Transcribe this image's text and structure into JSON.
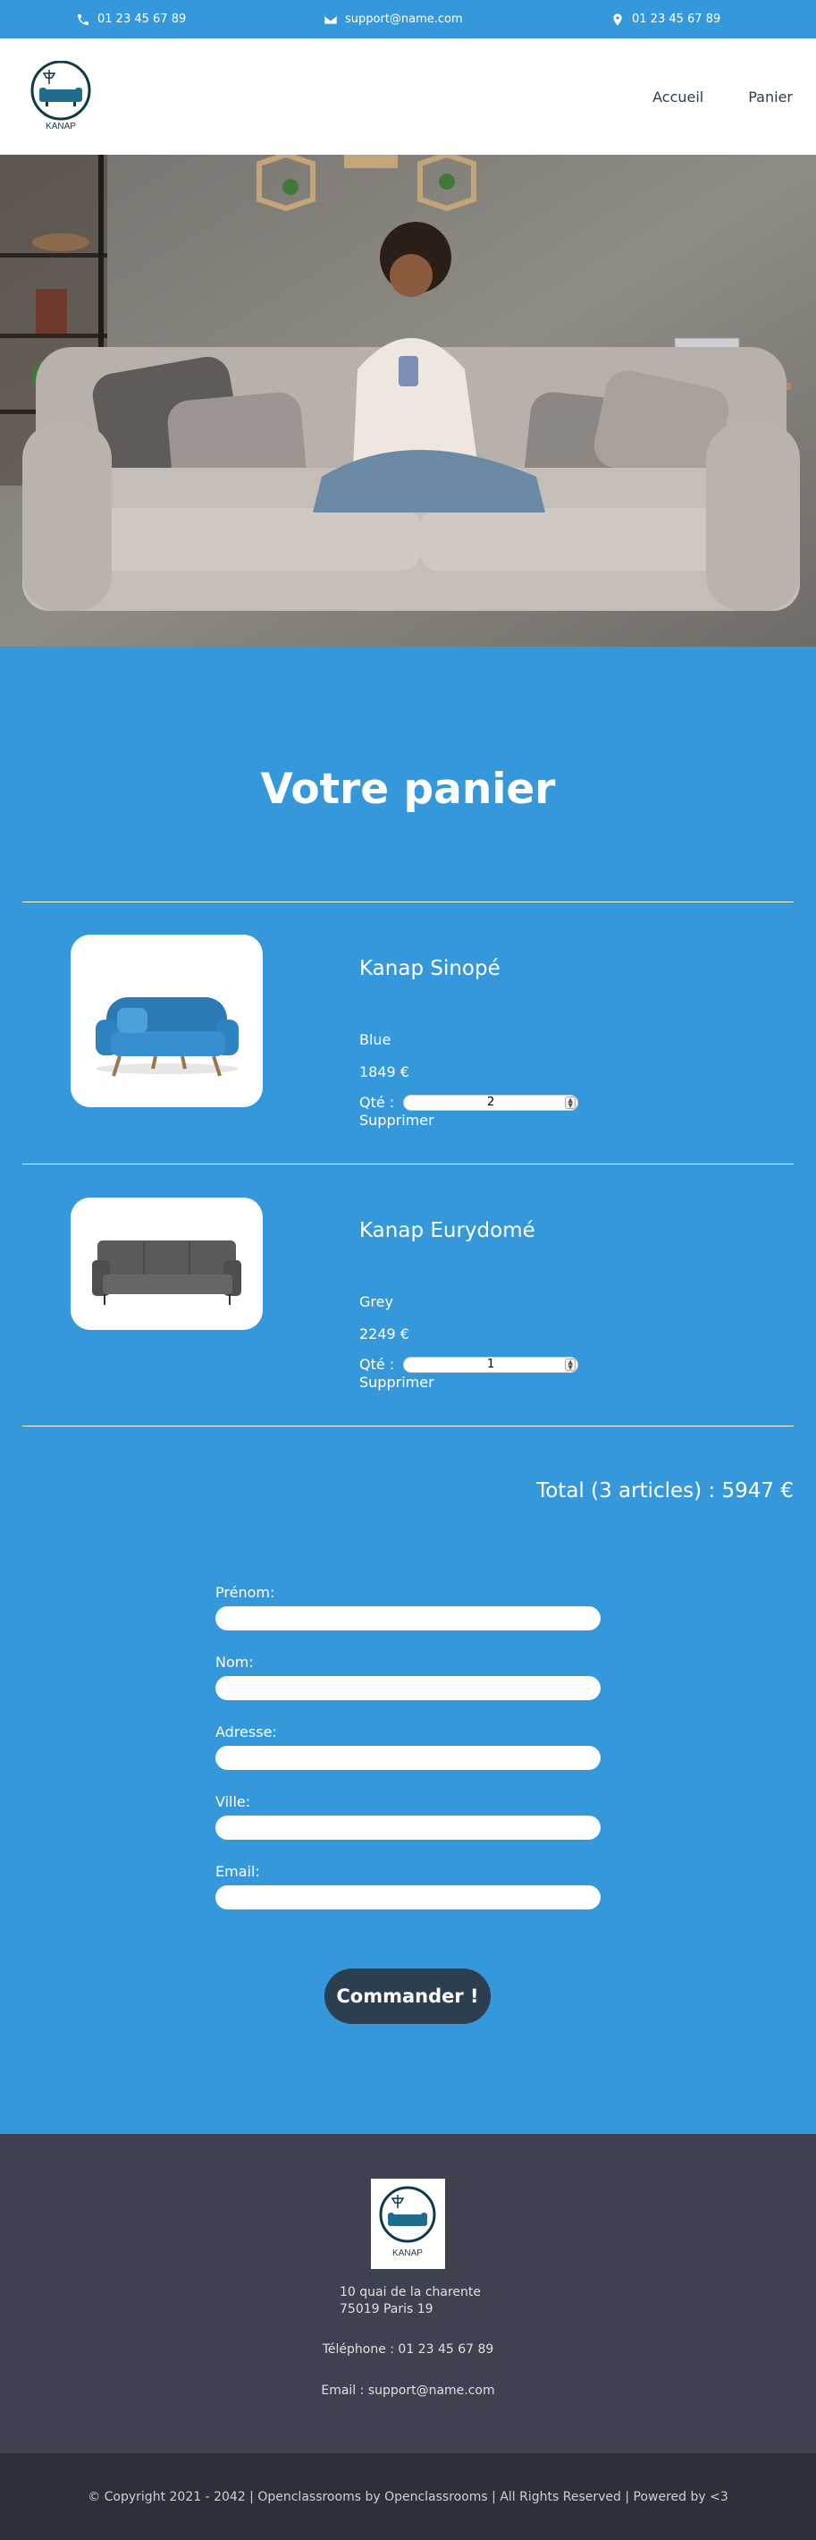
{
  "topbar": {
    "phone": "01 23 45 67 89",
    "email": "support@name.com",
    "location_phone": "01 23 45 67 89"
  },
  "header": {
    "logo_text": "KANAP",
    "nav": [
      "Accueil",
      "Panier"
    ]
  },
  "cart": {
    "title": "Votre panier",
    "qty_label": "Qté :",
    "delete_label": "Supprimer",
    "items": [
      {
        "name": "Kanap Sinopé",
        "color": "Blue",
        "price": "1849 €",
        "quantity": "2"
      },
      {
        "name": "Kanap Eurydomé",
        "color": "Grey",
        "price": "2249 €",
        "quantity": "1"
      }
    ],
    "total": "Total (3 articles) : 5947 €"
  },
  "form": {
    "labels": [
      "Prénom:",
      "Nom:",
      "Adresse:",
      "Ville:",
      "Email:"
    ],
    "submit": "Commander !"
  },
  "footer": {
    "logo_text": "KANAP",
    "address_line1": "10 quai de la charente",
    "address_line2": "75019 Paris 19",
    "phone": "Téléphone : 01 23 45 67 89",
    "email": "Email : support@name.com",
    "copyright": "© Copyright 2021 - 2042 | Openclassrooms by Openclassrooms | All Rights Reserved | Powered by <3"
  },
  "colors": {
    "primary": "#3498db",
    "dark": "#2c3e50",
    "footer": "#3d4150",
    "copyright_bg": "#2d2f3b"
  }
}
